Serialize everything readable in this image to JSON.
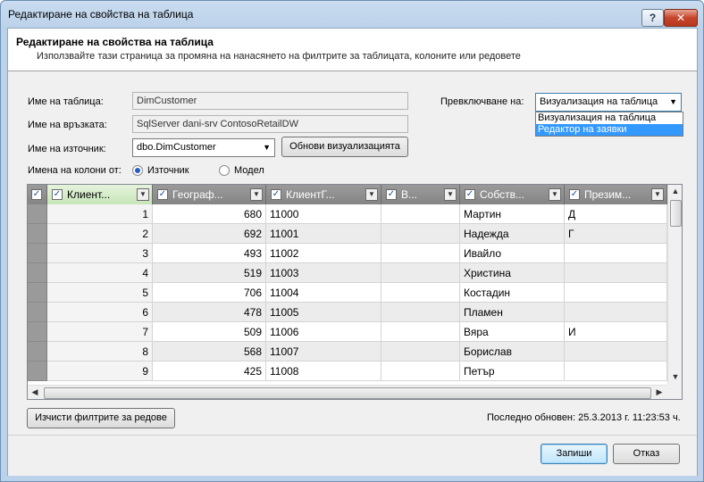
{
  "window": {
    "title": "Редактиране на свойства на таблица",
    "help_label": "?",
    "close_label": "✕"
  },
  "header": {
    "title": "Редактиране на свойства на таблица",
    "description": "Използвайте тази страница за промяна на нанасянето на филтрите за таблицата, колоните или редовете"
  },
  "form": {
    "table_name_label": "Име на таблица:",
    "table_name_value": "DimCustomer",
    "connection_label": "Име на връзката:",
    "connection_value": "SqlServer dani-srv ContosoRetailDW",
    "source_label": "Име на източник:",
    "source_value": "dbo.DimCustomer",
    "refresh_button": "Обнови визуализацията",
    "column_names_label": "Имена на колони от:",
    "radio_source": "Източник",
    "radio_model": "Модел",
    "radio_selected": "Източник",
    "switch_label": "Превключване на:",
    "switch_value": "Визуализация на таблица",
    "switch_options": [
      "Визуализация на таблица",
      "Редактор на заявки"
    ],
    "switch_highlighted": "Редактор на заявки"
  },
  "grid": {
    "columns": [
      "Клиент...",
      "Географ...",
      "КлиентГ...",
      "В...",
      "Собств...",
      "Презим..."
    ],
    "rows": [
      [
        "1",
        "680",
        "11000",
        "",
        "Мартин",
        "Д"
      ],
      [
        "2",
        "692",
        "11001",
        "",
        "Надежда",
        "Г"
      ],
      [
        "3",
        "493",
        "11002",
        "",
        "Ивайло",
        ""
      ],
      [
        "4",
        "519",
        "11003",
        "",
        "Христина",
        ""
      ],
      [
        "5",
        "706",
        "11004",
        "",
        "Костадин",
        ""
      ],
      [
        "6",
        "478",
        "11005",
        "",
        "Пламен",
        ""
      ],
      [
        "7",
        "509",
        "11006",
        "",
        "Вяра",
        "И"
      ],
      [
        "8",
        "568",
        "11007",
        "",
        "Борислав",
        ""
      ],
      [
        "9",
        "425",
        "11008",
        "",
        "Петър",
        ""
      ]
    ]
  },
  "footer": {
    "clear_filters_button": "Изчисти филтрите за редове",
    "last_refreshed": "Последно обновен: 25.3.2013 г. 11:23:53 ч.",
    "save_button": "Запиши",
    "cancel_button": "Отказ"
  }
}
